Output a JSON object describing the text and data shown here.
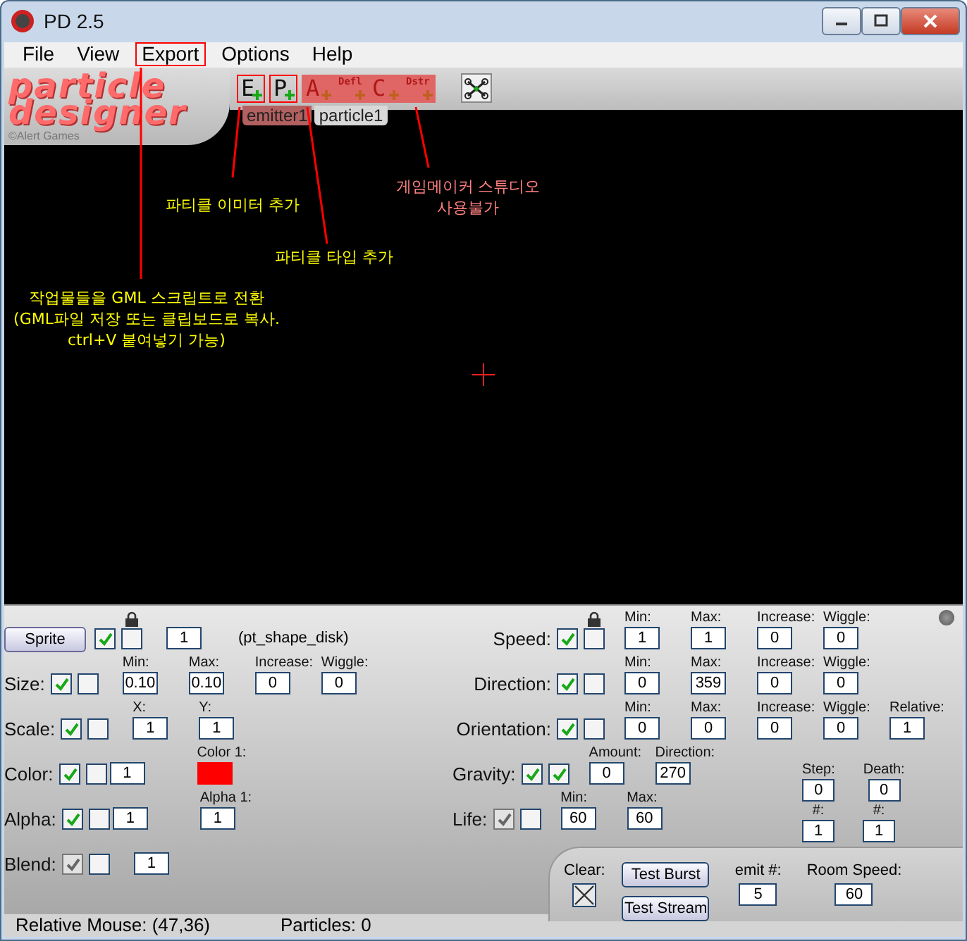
{
  "window": {
    "title": "PD 2.5"
  },
  "menu": [
    {
      "label": "File",
      "highlighted": false
    },
    {
      "label": "View",
      "highlighted": false
    },
    {
      "label": "Export",
      "highlighted": true
    },
    {
      "label": "Options",
      "highlighted": false
    },
    {
      "label": "Help",
      "highlighted": false
    }
  ],
  "logo": {
    "lines": [
      "particle",
      "designer"
    ],
    "credit": "©Alert Games"
  },
  "toolbar": [
    {
      "kind": "add",
      "label": "E",
      "highlighted": true,
      "unavailable": false
    },
    {
      "kind": "add",
      "label": "P",
      "highlighted": true,
      "unavailable": false
    },
    {
      "kind": "add",
      "label": "A",
      "highlighted": false,
      "unavailable": true
    },
    {
      "kind": "add-small",
      "label": "Defl",
      "highlighted": false,
      "unavailable": true
    },
    {
      "kind": "add",
      "label": "C",
      "highlighted": false,
      "unavailable": true
    },
    {
      "kind": "add-small",
      "label": "Dstr",
      "highlighted": false,
      "unavailable": true
    },
    {
      "kind": "tool"
    }
  ],
  "tabs": [
    {
      "label": "emitter1",
      "selected": false
    },
    {
      "label": "particle1",
      "selected": true
    }
  ],
  "annotations": [
    {
      "lines": [
        "파티클 이미터 추가"
      ],
      "color": "#ffff00"
    },
    {
      "lines": [
        "게임메이커 스튜디오",
        "사용불가"
      ],
      "color": "#ff8080"
    },
    {
      "lines": [
        "파티클 타입 추가"
      ],
      "color": "#ffff00"
    },
    {
      "lines": [
        "작업물들을 GML 스크립트로 전환",
        "(GML파일 저장 또는 클립보드로 복사.",
        "ctrl+V 붙여넣기 가능)"
      ],
      "color": "#ffff00"
    }
  ],
  "left_rows": [
    {
      "kind": "sprite",
      "button": "Sprite",
      "checks": [
        {
          "checked": true,
          "dimmed": false
        },
        {
          "checked": false,
          "dimmed": false
        }
      ],
      "fields": [
        {
          "value": "1"
        }
      ],
      "note": "(pt_shape_disk)"
    },
    {
      "kind": "row",
      "label": "Size:",
      "checks": [
        {
          "checked": true,
          "dimmed": false
        },
        {
          "checked": false,
          "dimmed": false
        }
      ],
      "fields": [
        {
          "label": "Min:",
          "value": "0.10"
        },
        {
          "label": "Max:",
          "value": "0.10"
        },
        {
          "label": "Increase:",
          "value": "0"
        },
        {
          "label": "Wiggle:",
          "value": "0"
        }
      ]
    },
    {
      "kind": "row",
      "label": "Scale:",
      "checks": [
        {
          "checked": true,
          "dimmed": false
        },
        {
          "checked": false,
          "dimmed": false
        }
      ],
      "fields": [
        {
          "label": "X:",
          "value": "1"
        },
        {
          "label": "Y:",
          "value": "1"
        }
      ]
    },
    {
      "kind": "row",
      "label": "Color:",
      "checks": [
        {
          "checked": true,
          "dimmed": false
        },
        {
          "checked": false,
          "dimmed": false
        }
      ],
      "fields": [
        {
          "kind": "count",
          "value": "1"
        },
        {
          "kind": "swatch",
          "label": "Color 1:",
          "color": "#ff0000"
        }
      ]
    },
    {
      "kind": "row",
      "label": "Alpha:",
      "checks": [
        {
          "checked": true,
          "dimmed": false
        },
        {
          "checked": false,
          "dimmed": false
        }
      ],
      "fields": [
        {
          "kind": "count",
          "value": "1"
        },
        {
          "label": "Alpha 1:",
          "value": "1"
        }
      ]
    },
    {
      "kind": "row",
      "label": "Blend:",
      "checks": [
        {
          "checked": true,
          "dimmed": true
        },
        {
          "checked": false,
          "dimmed": false
        }
      ],
      "fields": [
        {
          "value": "1"
        }
      ]
    }
  ],
  "right_rows": [
    {
      "label": "Speed:",
      "checks": [
        {
          "checked": true,
          "dimmed": false
        },
        {
          "checked": false,
          "dimmed": false
        }
      ],
      "fields": [
        {
          "label": "Min:",
          "value": "1"
        },
        {
          "label": "Max:",
          "value": "1"
        },
        {
          "label": "Increase:",
          "value": "0"
        },
        {
          "label": "Wiggle:",
          "value": "0"
        }
      ]
    },
    {
      "label": "Direction:",
      "checks": [
        {
          "checked": true,
          "dimmed": false
        },
        {
          "checked": false,
          "dimmed": false
        }
      ],
      "fields": [
        {
          "label": "Min:",
          "value": "0"
        },
        {
          "label": "Max:",
          "value": "359"
        },
        {
          "label": "Increase:",
          "value": "0"
        },
        {
          "label": "Wiggle:",
          "value": "0"
        }
      ]
    },
    {
      "label": "Orientation:",
      "checks": [
        {
          "checked": true,
          "dimmed": false
        },
        {
          "checked": false,
          "dimmed": false
        }
      ],
      "fields": [
        {
          "label": "Min:",
          "value": "0"
        },
        {
          "label": "Max:",
          "value": "0"
        },
        {
          "label": "Increase:",
          "value": "0"
        },
        {
          "label": "Wiggle:",
          "value": "0"
        },
        {
          "label": "Relative:",
          "value": "1"
        }
      ]
    },
    {
      "label": "Gravity:",
      "checks": [
        {
          "checked": true,
          "dimmed": false
        },
        {
          "checked": true,
          "dimmed": false
        }
      ],
      "fields": [
        {
          "label": "Amount:",
          "value": "0"
        },
        {
          "label": "Direction:",
          "value": "270"
        }
      ]
    },
    {
      "label": "Life:",
      "checks": [
        {
          "checked": true,
          "dimmed": true
        },
        {
          "checked": false,
          "dimmed": false
        }
      ],
      "fields": [
        {
          "label": "Min:",
          "value": "60"
        },
        {
          "label": "Max:",
          "value": "60"
        }
      ]
    }
  ],
  "timing": [
    {
      "label": "Step:",
      "value": "0"
    },
    {
      "label": "Death:",
      "value": "0"
    }
  ],
  "counts": [
    {
      "label": "#:",
      "value": "1"
    },
    {
      "label": "#:",
      "value": "1"
    }
  ],
  "controls": {
    "clear": {
      "label": "Clear:",
      "checked": true
    },
    "buttons": [
      "Test Burst",
      "Test Stream"
    ],
    "emit": {
      "label": "emit #:",
      "value": "5"
    },
    "room_speed": {
      "label": "Room Speed:",
      "value": "60"
    }
  },
  "status_bar": [
    "Relative Mouse: (47,36)",
    "Particles: 0"
  ]
}
